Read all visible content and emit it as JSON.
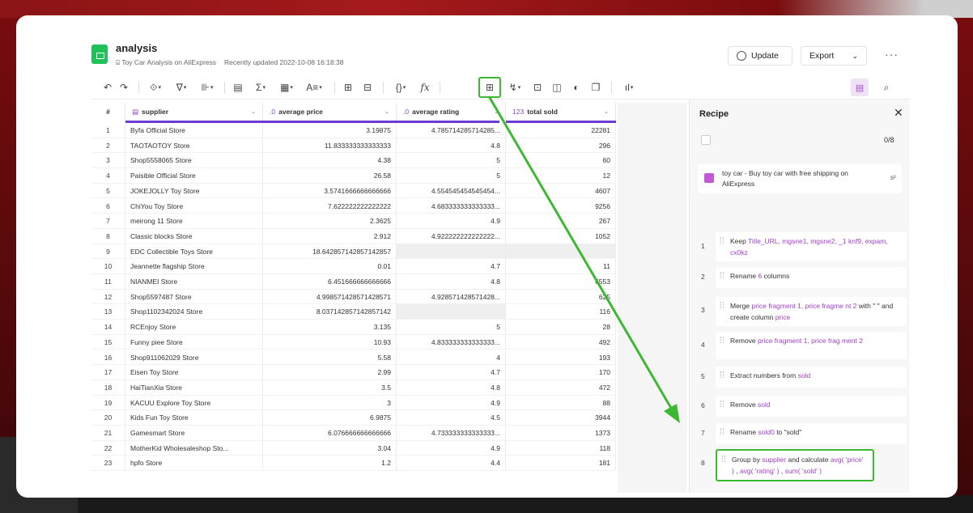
{
  "app": {
    "title": "analysis",
    "subtitle_project": "Toy Car Analysis on AliExpress",
    "subtitle_updated": "Recently updated 2022-10-08 16:18:38",
    "update_label": "Update",
    "export_label": "Export",
    "more_label": "···"
  },
  "toolbar": {
    "icons": [
      "undo-icon",
      "redo-icon",
      "column-ops-icon",
      "filter-icon",
      "column-split-icon",
      "table-icon",
      "sum-icon",
      "calendar-icon",
      "text-format-icon",
      "merge-grid-icon",
      "split-grid-icon",
      "braces-icon",
      "formula-icon",
      "group-by-icon",
      "pivot-icon",
      "pin-icon",
      "layout-icon",
      "join-icon",
      "copy-icon",
      "chart-icon",
      "recipe-view-icon",
      "search-view-icon"
    ],
    "glyphs": {
      "undo": "↶",
      "redo": "↷",
      "ops": "⟐",
      "filter": "∇",
      "split": "⊪",
      "table": "▤",
      "sum": "Σ",
      "calendar": "▦",
      "textfmt": "A≡",
      "merge": "⊞",
      "splitgrid": "⊟",
      "braces": "{}",
      "fx": "fx",
      "groupby": "⊞",
      "pivot": "↯",
      "pin": "⊡",
      "layout": "◫",
      "join": "◐",
      "copy": "❐",
      "chart": "ıl",
      "recipe": "▤",
      "search": "⌕"
    }
  },
  "grid": {
    "columns": [
      {
        "type": "▤",
        "name": "supplier"
      },
      {
        "type": ".0",
        "name": "average price"
      },
      {
        "type": ".0",
        "name": "average rating"
      },
      {
        "type": "123",
        "name": "total sold"
      }
    ],
    "rows": [
      [
        "1",
        "Byfa Official Store",
        "3.19875",
        "4.785714285714285...",
        "22281"
      ],
      [
        "2",
        "TAOTAOTOY Store",
        "11.833333333333333",
        "4.8",
        "296"
      ],
      [
        "3",
        "Shop5558065 Store",
        "4.38",
        "5",
        "60"
      ],
      [
        "4",
        "Paisible Official Store",
        "26.58",
        "5",
        "12"
      ],
      [
        "5",
        "JOKEJOLLY Toy Store",
        "3.5741666666666666",
        "4.554545454545454...",
        "4607"
      ],
      [
        "6",
        "ChiYou Toy Store",
        "7.622222222222222",
        "4.683333333333333...",
        "9256"
      ],
      [
        "7",
        "meirong 11 Store",
        "2.3625",
        "4.9",
        "267"
      ],
      [
        "8",
        "Classic blocks Store",
        "2.912",
        "4.922222222222222...",
        "1052"
      ],
      [
        "9",
        "EDC Collectible Toys Store",
        "18.642857142857142857",
        "",
        ""
      ],
      [
        "10",
        "Jeannette flagship Store",
        "0.01",
        "4.7",
        "11"
      ],
      [
        "11",
        "NIANMEI Store",
        "6.451666666666666",
        "4.8",
        "6553"
      ],
      [
        "12",
        "Shop5597487 Store",
        "4.998571428571428571",
        "4.928571428571428...",
        "625"
      ],
      [
        "13",
        "Shop1102342024 Store",
        "8.037142857142857142",
        "",
        "116"
      ],
      [
        "14",
        "RCEnjoy Store",
        "3.135",
        "5",
        "28"
      ],
      [
        "15",
        "Funny piee Store",
        "10.93",
        "4.833333333333333...",
        "492"
      ],
      [
        "16",
        "Shop911062029 Store",
        "5.58",
        "4",
        "193"
      ],
      [
        "17",
        "Eisen Toy Store",
        "2.99",
        "4.7",
        "170"
      ],
      [
        "18",
        "HaiTianXia Store",
        "3.5",
        "4.8",
        "472"
      ],
      [
        "19",
        "KACUU Explore Toy Store",
        "3",
        "4.9",
        "88"
      ],
      [
        "20",
        "Kids Fun Toy Store",
        "6.9875",
        "4.5",
        "3944"
      ],
      [
        "21",
        "Gamesmart Store",
        "6.076666666666666",
        "4.733333333333333...",
        "1373"
      ],
      [
        "22",
        "MotherKid Wholesaleshop Sto...",
        "3.04",
        "4.9",
        "118"
      ],
      [
        "23",
        "hpfo Store",
        "1.2",
        "4.4",
        "181"
      ]
    ]
  },
  "recipe": {
    "title": "Recipe",
    "close": "✕",
    "count": "0/8",
    "source": "toy car - Buy toy car with free shipping on AliExpress",
    "source_sym": "s²",
    "steps": [
      {
        "num": "1",
        "parts": [
          {
            "t": "Keep "
          },
          {
            "t": "Title_URL, mgsne1, mgsne2, _1 knf9, expam, cx0kz",
            "h": true
          }
        ]
      },
      {
        "num": "2",
        "parts": [
          {
            "t": "Rename "
          },
          {
            "t": "6",
            "h": true
          },
          {
            "t": " columns"
          }
        ]
      },
      {
        "num": "3",
        "parts": [
          {
            "t": "Merge "
          },
          {
            "t": "price fragment 1, price fragme nt 2",
            "h": true
          },
          {
            "t": " with \" \" and create column "
          },
          {
            "t": "price",
            "h": true
          }
        ]
      },
      {
        "num": "4",
        "parts": [
          {
            "t": "Remove "
          },
          {
            "t": "price fragment 1, price frag ment 2",
            "h": true
          }
        ]
      },
      {
        "num": "5",
        "parts": [
          {
            "t": "Extract numbers from "
          },
          {
            "t": "sold",
            "h": true
          }
        ]
      },
      {
        "num": "6",
        "parts": [
          {
            "t": "Remove "
          },
          {
            "t": "sold",
            "h": true
          }
        ]
      },
      {
        "num": "7",
        "parts": [
          {
            "t": "Rename "
          },
          {
            "t": "sold0",
            "h": true
          },
          {
            "t": " to \"sold\""
          }
        ]
      },
      {
        "num": "8",
        "parts": [
          {
            "t": "Group by "
          },
          {
            "t": "supplier",
            "h": true
          },
          {
            "t": " and calculate "
          },
          {
            "t": "avg( 'price' )",
            "h": true
          },
          {
            "t": " , "
          },
          {
            "t": "avg( 'rating' )",
            "h": true
          },
          {
            "t": " , "
          },
          {
            "t": "sum( 'sold' )",
            "h": true
          }
        ]
      }
    ]
  },
  "colors": {
    "accent": "#6c3bd1",
    "highlight": "#a23fc7",
    "arrow": "#3db832",
    "logo": "#1fc25a"
  }
}
